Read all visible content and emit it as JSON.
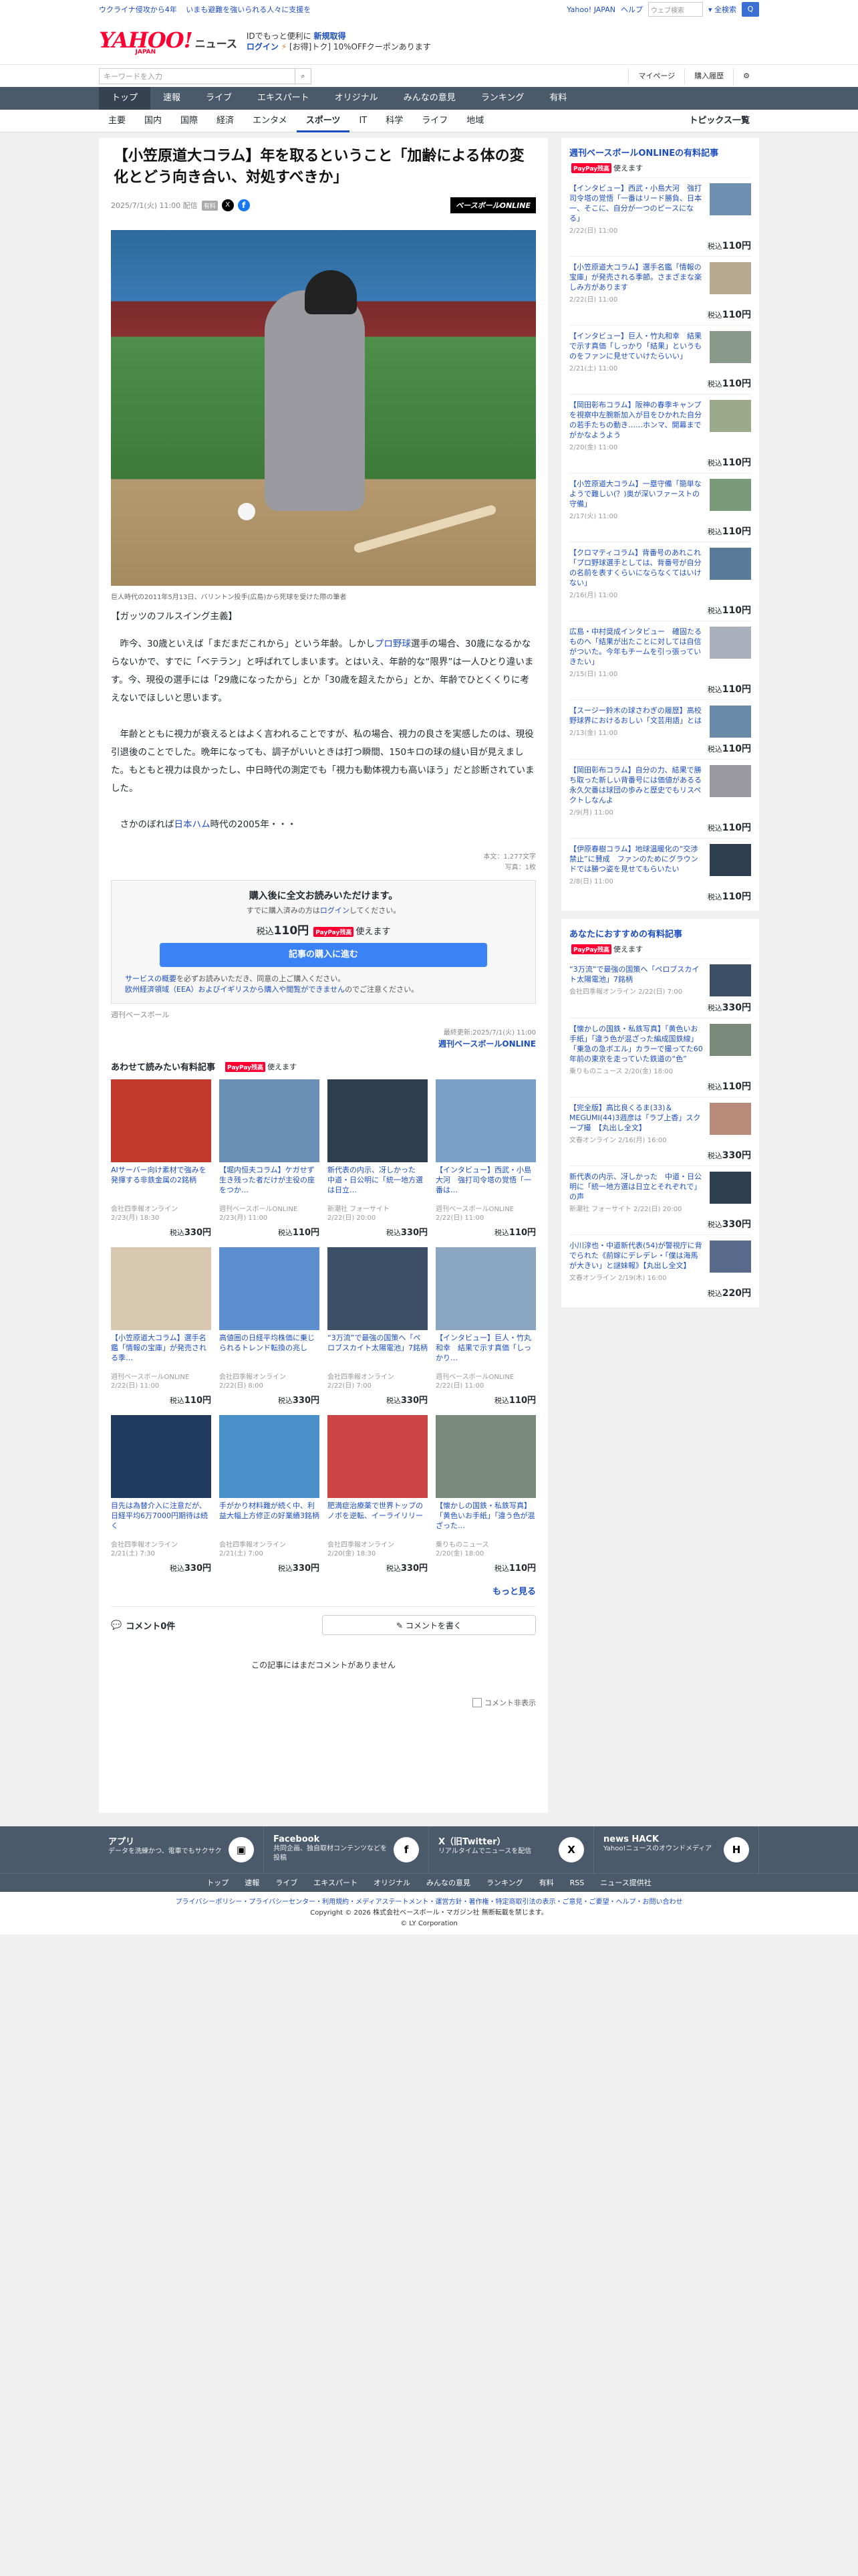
{
  "topbar": {
    "links": [
      "ウクライナ侵攻から4年",
      "いまも避難を強いられる人々に支援を"
    ],
    "yahoo_japan": "Yahoo! JAPAN",
    "help": "ヘルプ",
    "search_placeholder": "ウェブ検索",
    "search_type": "▾ 全検索",
    "search_btn": "Q"
  },
  "header": {
    "logo_y": "YAHOO!",
    "logo_jp": "JAPAN",
    "logo_news": "ニュース",
    "promo_l1a": "IDでもっと便利に",
    "promo_l1b": "新規取得",
    "promo_l2a": "ログイン",
    "promo_l3": "[お得]トク] 10%OFFクーポンあります"
  },
  "searchrow": {
    "placeholder": "キーワードを入力",
    "mypage": "マイページ",
    "history": "購入履歴"
  },
  "nav1": [
    "トップ",
    "速報",
    "ライブ",
    "エキスパート",
    "オリジナル",
    "みんなの意見",
    "ランキング",
    "有料"
  ],
  "nav2": [
    "主要",
    "国内",
    "国際",
    "経済",
    "エンタメ",
    "スポーツ",
    "IT",
    "科学",
    "ライフ",
    "地域"
  ],
  "nav2_topics": "トピックス一覧",
  "article": {
    "title": "【小笠原道大コラム】年を取るということ「加齢による体の変化とどう向き合い、対処すべきか」",
    "date": "2025/7/1(火) 11:00 配信",
    "badge": "有料",
    "publisher_logo": "ベースボールONLINE",
    "caption": "巨人時代の2011年5月13日、バリントン投手(広島)から死球を受けた際の筆者",
    "subhead": "【ガッツのフルスイング主義】",
    "p1a": "　昨今、30歳といえば「まだまだこれから」という年齢。しかし",
    "p1link": "プロ野球",
    "p1b": "選手の場合、30歳になるかならないかで、すでに「ベテラン」と呼ばれてしまいます。とはいえ、年齢的な“限界”は一人ひとり違います。今、現役の選手には「29歳になったから」とか「30歳を超えたから」とか、年齢でひとくくりに考えないでほしいと思います。",
    "p2": "　年齢とともに視力が衰えるとはよく言われることですが、私の場合、視力の良さを実感したのは、現役引退後のことでした。晩年になっても、調子がいいときは打つ瞬間、150キロの球の縫い目が見えました。もともと視力は良かったし、中日時代の測定でも「視力も動体視力も高いほう」だと診断されていました。",
    "p3a": "　さかのぼれば",
    "p3link": "日本ハム",
    "p3b": "時代の2005年・・・",
    "chars": "本文：1,277文字",
    "photos": "写真：1枚"
  },
  "paywall": {
    "heading": "購入後に全文お読みいただけます。",
    "sub_a": "すでに購入済みの方は",
    "sub_link": "ログイン",
    "sub_b": "してください。",
    "price_pre": "税込",
    "price": "110円",
    "pp_label": "PayPay残高",
    "pp_suffix": "使えます",
    "buy_btn": "記事の購入に進む",
    "note1_link": "サービスの概要",
    "note1_b": "を必ずお読みいただき、同意の上ご購入ください。",
    "note2_link": "欧州経済領域（EEA）およびイギリスから購入や閲覧ができません",
    "note2_b": "のでご注意ください。"
  },
  "source_name": "週刊ベースボール",
  "updated": "最終更新:2025/7/1(火) 11:00",
  "source_link": "週刊ベースボールONLINE",
  "related": {
    "heading": "あわせて読みたい有料記事",
    "pp_label": "PayPay残高",
    "pp_suffix": "使えます",
    "items": [
      {
        "title": "AIサーバー向け素材で強みを発揮する非鉄金属の2銘柄",
        "src": "会社四季報オンライン",
        "date": "2/23(月) 18:30",
        "price": "330円",
        "color": "#c0392b"
      },
      {
        "title": "【堀内恒夫コラム】ケガせず生き残った者だけが主役の座をつか…",
        "src": "週刊ベースボールONLINE",
        "date": "2/23(月) 11:00",
        "price": "110円",
        "color": "#6a8fb5"
      },
      {
        "title": "新代表の内示、冴しかった　中道・日公明に「統一地方選は日立…",
        "src": "新潮社 フォーサイト",
        "date": "2/22(日) 20:00",
        "price": "330円",
        "color": "#2c3e50"
      },
      {
        "title": "【インタビュー】西武・小島大河　強打司令塔の覚悟「一番は…",
        "src": "週刊ベースボールONLINE",
        "date": "2/22(日) 11:00",
        "price": "110円",
        "color": "#7aa0c8"
      },
      {
        "title": "【小笠原道大コラム】選手名鑑「情報の宝庫」が発売される季…",
        "src": "週刊ベースボールONLINE",
        "date": "2/22(日) 11:00",
        "price": "110円",
        "color": "#d9c8b0"
      },
      {
        "title": "高値圏の日経平均株価に乗じられるトレンド転換の兆し",
        "src": "会社四季報オンライン",
        "date": "2/22(日) 8:00",
        "price": "330円",
        "color": "#5d8fcf"
      },
      {
        "title": "“3万流”で最強の国策へ「ペロブスカイト太陽電池」7銘柄",
        "src": "会社四季報オンライン",
        "date": "2/22(日) 7:00",
        "price": "330円",
        "color": "#3d4f66"
      },
      {
        "title": "【インタビュー】巨人・竹丸和幸　結果で示す真価「しっかり…",
        "src": "週刊ベースボールONLINE",
        "date": "2/22(日) 11:00",
        "price": "110円",
        "color": "#8aa6c0"
      },
      {
        "title": "目先は為替介入に注意だが、日経平均6万7000円期待は続く",
        "src": "会社四季報オンライン",
        "date": "2/21(土) 7:30",
        "price": "330円",
        "color": "#1f3a5c"
      },
      {
        "title": "手がかり材料難が続く中、利益大幅上方修正の好業績3銘柄",
        "src": "会社四季報オンライン",
        "date": "2/21(土) 7:00",
        "price": "330円",
        "color": "#4a90c8"
      },
      {
        "title": "肥満症治療薬で世界トップのノボを逆転、イーライリリー",
        "src": "会社四季報オンライン",
        "date": "2/20(金) 18:30",
        "price": "330円",
        "color": "#c44"
      },
      {
        "title": "【懐かしの国鉄・私鉄写真】「黄色いお手紙」「違う色が混ざった…",
        "src": "乗りものニュース",
        "date": "2/20(金) 18:00",
        "price": "110円",
        "color": "#7a8a7a"
      }
    ],
    "more": "もっと見る"
  },
  "comments": {
    "title": "コメント0件",
    "write_btn": "コメントを書く",
    "none": "この記事にはまだコメントがありません",
    "hide": "コメント非表示"
  },
  "sidebar1": {
    "heading": "週刊ベースボールONLINEの有料記事",
    "pp_label": "PayPay残高",
    "pp_suffix": "使えます",
    "items": [
      {
        "title": "【インタビュー】西武・小島大河　強打司令塔の覚悟「一番はリード勝負、日本一、そこに、自分が一つのピースになる」",
        "date": "2/22(日) 11:00",
        "price": "110円",
        "color": "#6f8fb0"
      },
      {
        "title": "【小笠原道大コラム】選手名鑑「情報の宝庫」が発売される季節。さまざまな楽しみ方があります",
        "date": "2/22(日) 11:00",
        "price": "110円",
        "color": "#b8a890"
      },
      {
        "title": "【インタビュー】巨人・竹丸和幸　結果で示す真価「しっかり「結果」というものをファンに見せていけたらいい」",
        "date": "2/21(土) 11:00",
        "price": "110円",
        "color": "#8a9a8a"
      },
      {
        "title": "【岡田彰布コラム】阪神の春季キャンプを視察中左腕新加入が目をひかれた自分の若手たちの動き……ホンマ、開幕までがかなようよう",
        "date": "2/20(金) 11:00",
        "price": "110円",
        "color": "#9aaa8a"
      },
      {
        "title": "【小笠原道大コラム】一塁守備「簡単なようで難しい(？)奥が深いファーストの守備」",
        "date": "2/17(火) 11:00",
        "price": "110円",
        "color": "#7a9a7a"
      },
      {
        "title": "【クロマティコラム】背番号のあれこれ「プロ野球選手としては、背番号が自分の名前を表すくらいにならなくてはいけない」",
        "date": "2/16(月) 11:00",
        "price": "110円",
        "color": "#5a7a9a"
      },
      {
        "title": "広島・中村奨成インタビュー　確固たるものへ「結果が出たことに対しては自信がついた。今年もチームを引っ張っていきたい」",
        "date": "2/15(日) 11:00",
        "price": "110円",
        "color": "#aab0bb"
      },
      {
        "title": "【スージー鈴木の球さわぎの履歴】高校野球界におけるおしい「文芸用語」とは",
        "date": "2/13(金) 11:00",
        "price": "110円",
        "color": "#6a8aaa"
      },
      {
        "title": "【岡田彰布コラム】自分の力、結果で勝ち取った新しい背番号には価値があるる　永久欠番は球団の歩みと歴史でもリスペクトしなんよ",
        "date": "2/9(月) 11:00",
        "price": "110円",
        "color": "#9a9aa0"
      },
      {
        "title": "【伊原春樹コラム】地球温暖化の“交渉禁止”に賛成　ファンのためにグラウンドでは勝つ姿を見せてもらいたい",
        "date": "2/8(日) 11:00",
        "price": "110円",
        "color": "#2c3e50"
      }
    ]
  },
  "sidebar2": {
    "heading": "あなたにおすすめの有料記事",
    "pp_label": "PayPay残高",
    "pp_suffix": "使えます",
    "items": [
      {
        "title": "“3万流”で最強の国策へ「ペロブスカイト太陽電池」7銘柄",
        "date": "会社四季報オンライン 2/22(日) 7:00",
        "price": "330円",
        "color": "#3d4f66"
      },
      {
        "title": "【懐かしの国鉄・私鉄写真】「黄色いお手紙」「違う色が混ざった編成国鉄線」「乗急の急ボエル」カラーで撮ってた60年前の東京を走っていた鉄道の“色”",
        "date": "乗りものニュース 2/20(金) 18:00",
        "price": "110円",
        "color": "#7a8a7a"
      },
      {
        "title": "【完全版】高比良くるま(33)＆MEGUMI(44)3週彦は「ラブ上香」スクープ撮　【丸出し全文】",
        "date": "文春オンライン 2/16(月) 16:00",
        "price": "330円",
        "color": "#b88a7a"
      },
      {
        "title": "新代表の内示、冴しかった　中道・日公明に「統一地方選は日立とそれぞれで」の声",
        "date": "新潮社 フォーサイト 2/22(日) 20:00",
        "price": "330円",
        "color": "#2c3e50"
      },
      {
        "title": "小川淳也・中道新代表(54)が警視庁に背でられた《前嫁にデレデレ・「僕は海馬が大きい」と謎妹報》【丸出し全文】",
        "date": "文春オンライン 2/19(木) 16:00",
        "price": "220円",
        "color": "#5a6a8a"
      }
    ]
  },
  "footer": {
    "cells": [
      {
        "title": "アプリ",
        "desc": "データを洗練かつ、電車でもサクサク",
        "icon": "app"
      },
      {
        "title": "Facebook",
        "desc": "共同企画、独自取材コンテンツなどを投稿",
        "icon": "f"
      },
      {
        "title": "X（旧Twitter）",
        "desc": "リアルタイムでニュースを配信",
        "icon": "X"
      },
      {
        "title": "news HACK",
        "desc": "Yahoo!ニュースのオウンドメディア",
        "icon": "HACK"
      }
    ],
    "nav": [
      "トップ",
      "速報",
      "ライブ",
      "エキスパート",
      "オリジナル",
      "みんなの意見",
      "ランキング",
      "有料",
      "RSS",
      "ニュース提供社"
    ],
    "legal": "プライバシーポリシー・プライバシーセンター・利用規約・メディアステートメント・運営方針・著作権・特定商取引法の表示・ご意見・ご要望・ヘルプ・お問い合わせ",
    "copyright": "Copyright © 2026 株式会社ベースボール・マガジン社 無断転載を禁じます。",
    "ly": "© LY Corporation"
  }
}
